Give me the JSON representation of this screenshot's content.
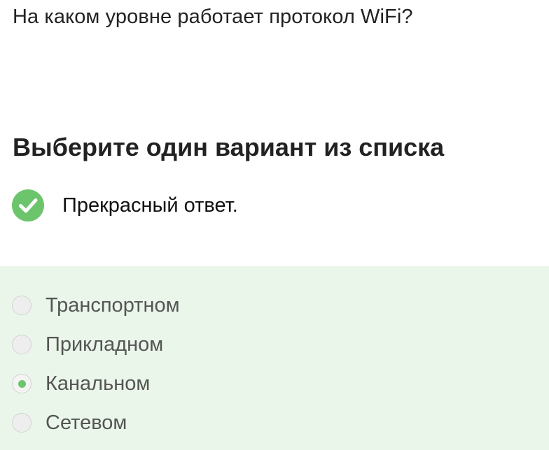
{
  "question": {
    "text": "На каком уровне работает протокол WiFi?"
  },
  "instruction": {
    "text": "Выберите один вариант из списка"
  },
  "feedback": {
    "icon": "check-circle-icon",
    "text": "Прекрасный ответ.",
    "color": "#6cc56c"
  },
  "options": {
    "panel_color": "#eaf6ea",
    "items": [
      {
        "label": "Транспортном",
        "selected": false
      },
      {
        "label": "Прикладном",
        "selected": false
      },
      {
        "label": "Канальном",
        "selected": true
      },
      {
        "label": "Сетевом",
        "selected": false
      }
    ]
  }
}
